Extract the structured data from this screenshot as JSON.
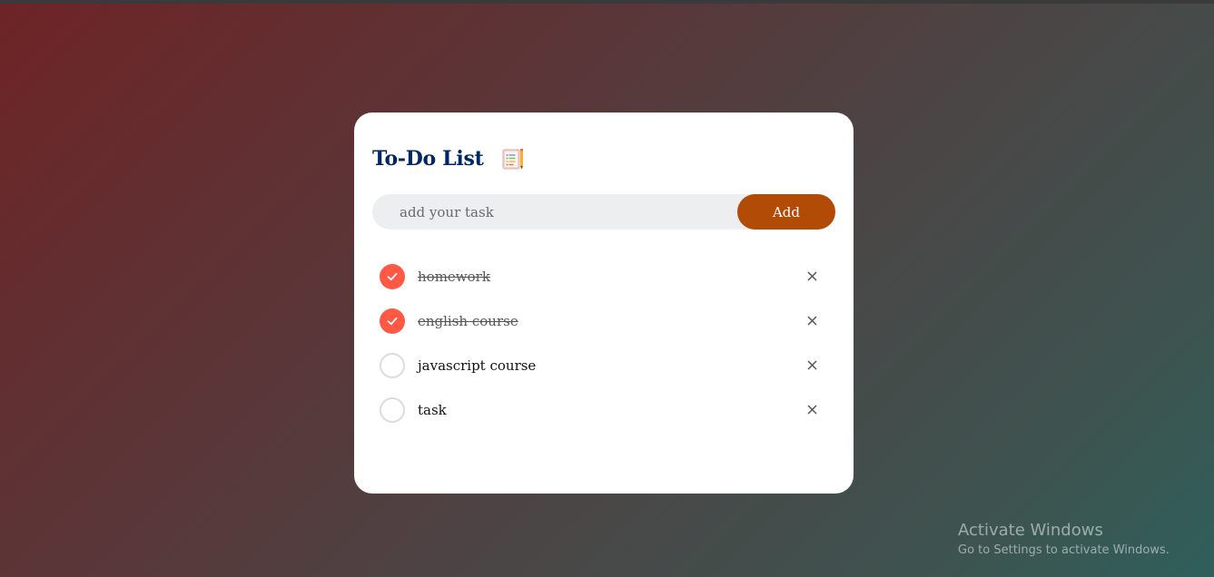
{
  "app": {
    "title": "To-Do List",
    "title_icon": "notepad-icon"
  },
  "input": {
    "value": "",
    "placeholder": "add your task",
    "add_label": "Add"
  },
  "tasks": [
    {
      "label": "homework",
      "done": true
    },
    {
      "label": "english course",
      "done": true
    },
    {
      "label": "javascript course",
      "done": false
    },
    {
      "label": "task",
      "done": false
    }
  ],
  "icons": {
    "check": "check-icon",
    "remove": "close-icon"
  },
  "colors": {
    "title": "#002765",
    "accent_button": "#b24b06",
    "checked": "#ff5945"
  },
  "watermark": {
    "title": "Activate Windows",
    "subtitle": "Go to Settings to activate Windows."
  }
}
